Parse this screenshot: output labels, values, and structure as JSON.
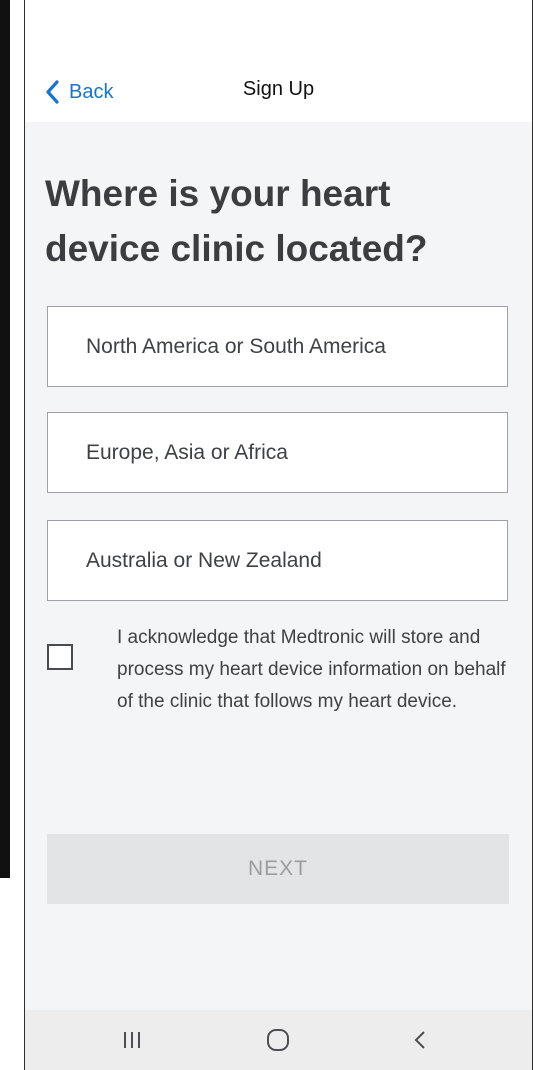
{
  "header": {
    "back_label": "Back",
    "title": "Sign Up"
  },
  "main": {
    "title": "Where is your heart device clinic located?",
    "options": [
      {
        "label": "North America or South America"
      },
      {
        "label": "Europe, Asia or Africa"
      },
      {
        "label": "Australia or New Zealand"
      }
    ],
    "acknowledgement": {
      "checked": false,
      "text": "I acknowledge that Medtronic will store and process my heart device information on behalf of the clinic that follows my heart device."
    },
    "next_label": "NEXT"
  },
  "nav_bar": {
    "icons": [
      "recent-apps-icon",
      "home-icon",
      "system-back-icon"
    ]
  },
  "colors": {
    "accent": "#1a74c7",
    "background": "#f4f5f6",
    "button_disabled_bg": "#e3e4e6",
    "button_disabled_text": "#9b9da0"
  }
}
